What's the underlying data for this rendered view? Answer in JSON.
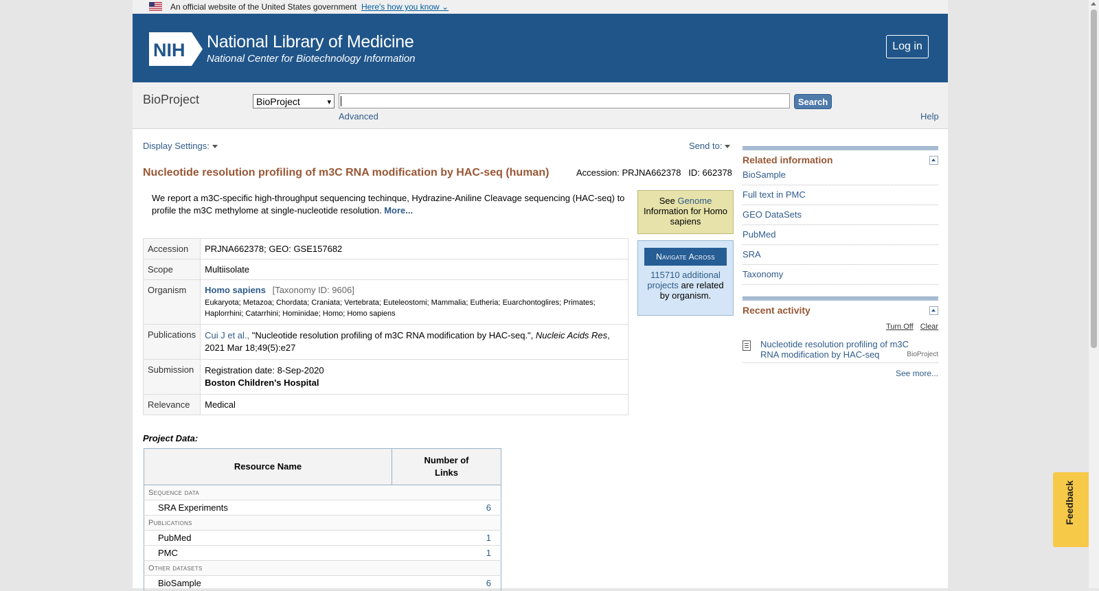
{
  "gov_banner": {
    "text": "An official website of the United States government",
    "link": "Here's how you know"
  },
  "header": {
    "logo_text": "NIH",
    "title": "National Library of Medicine",
    "subtitle": "National Center for Biotechnology Information",
    "login": "Log in"
  },
  "search": {
    "db_name": "BioProject",
    "selected_db": "BioProject",
    "query": "",
    "button": "Search",
    "advanced": "Advanced",
    "help": "Help"
  },
  "toolbar": {
    "display_settings": "Display Settings:",
    "send_to": "Send to:"
  },
  "record": {
    "title": "Nucleotide resolution profiling of m3C RNA modification by HAC-seq (human)",
    "accession_line": "Accession: PRJNA662378   ID: 662378",
    "description": "We report a m3C-specific high-throughput sequencing techinque, Hydrazine-Aniline Cleavage sequencing (HAC-seq) to profile the m3C methylome at single-nucleotide resolution.",
    "more": "More...",
    "rows": {
      "accession_label": "Accession",
      "accession_value": "PRJNA662378; GEO: GSE157682",
      "scope_label": "Scope",
      "scope_value": "Multiisolate",
      "organism_label": "Organism",
      "organism_name": "Homo sapiens",
      "taxonomy_id": "[Taxonomy ID: 9606]",
      "lineage": "Eukaryota; Metazoa; Chordata; Craniata; Vertebrata; Euteleostomi; Mammalia; Eutheria; Euarchontoglires; Primates; Haplorrhini; Catarrhini; Hominidae; Homo; Homo sapiens",
      "publications_label": "Publications",
      "pub_authors": "Cui J et al.,",
      "pub_title": " \"Nucleotide resolution profiling of m3C RNA modification by HAC-seq.\", ",
      "pub_journal": "Nucleic Acids Res",
      "pub_date": ", 2021 Mar 18;49(5):e27",
      "submission_label": "Submission",
      "registration": "Registration date: 8-Sep-2020",
      "institution": "Boston Children's Hospital",
      "relevance_label": "Relevance",
      "relevance_value": "Medical"
    }
  },
  "genome_box": {
    "pre": "See ",
    "link": "Genome",
    "post": " Information for Homo sapiens"
  },
  "navigate_box": {
    "title": "Navigate Across",
    "link": "115710 additional projects",
    "post": " are related by organism."
  },
  "project_data": {
    "label": "Project Data:",
    "col_resource": "Resource Name",
    "col_links": "Number of Links",
    "rows": [
      {
        "type": "category",
        "name": "Sequence data"
      },
      {
        "type": "item",
        "name": "SRA Experiments",
        "count": "6"
      },
      {
        "type": "category",
        "name": "Publications"
      },
      {
        "type": "item",
        "name": "PubMed",
        "count": "1"
      },
      {
        "type": "item",
        "name": "PMC",
        "count": "1"
      },
      {
        "type": "category",
        "name": "Other datasets"
      },
      {
        "type": "item",
        "name": "BioSample",
        "count": "6"
      }
    ]
  },
  "related": {
    "title": "Related information",
    "items": [
      "BioSample",
      "Full text in PMC",
      "GEO DataSets",
      "PubMed",
      "SRA",
      "Taxonomy"
    ]
  },
  "recent": {
    "title": "Recent activity",
    "turn_off": "Turn Off",
    "clear": "Clear",
    "item_text": "Nucleotide resolution profiling of m3C RNA modification by HAC-seq",
    "item_db": "BioProject",
    "see_more": "See more..."
  },
  "feedback": "Feedback"
}
